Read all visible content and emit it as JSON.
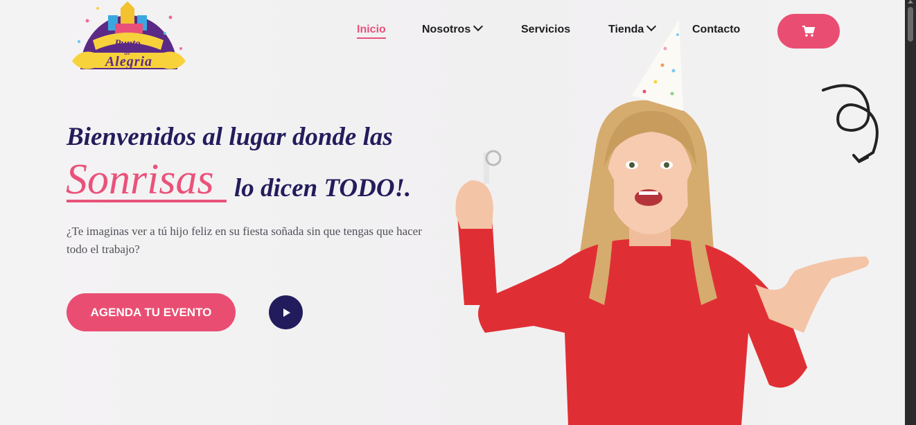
{
  "brand": {
    "logo_lines": [
      "Punto",
      "de",
      "Alegria"
    ]
  },
  "nav": {
    "items": [
      {
        "label": "Inicio",
        "active": true
      },
      {
        "label": "Nosotros",
        "dropdown": true
      },
      {
        "label": "Servicios"
      },
      {
        "label": "Tienda",
        "dropdown": true
      },
      {
        "label": "Contacto"
      }
    ],
    "cart_icon": "cart-icon"
  },
  "hero": {
    "line1": "Bienvenidos al lugar donde las",
    "highlight": "Sonrisas",
    "line2": "lo dicen TODO!.",
    "subtitle": "¿Te imaginas ver a tú hijo feliz en su fiesta soñada sin que tengas que hacer todo el trabajo?",
    "cta_label": "AGENDA TU EVENTO",
    "play_icon": "play-icon"
  },
  "colors": {
    "accent": "#e94e72",
    "navy": "#231c5c",
    "background": "#f2f1f2"
  }
}
